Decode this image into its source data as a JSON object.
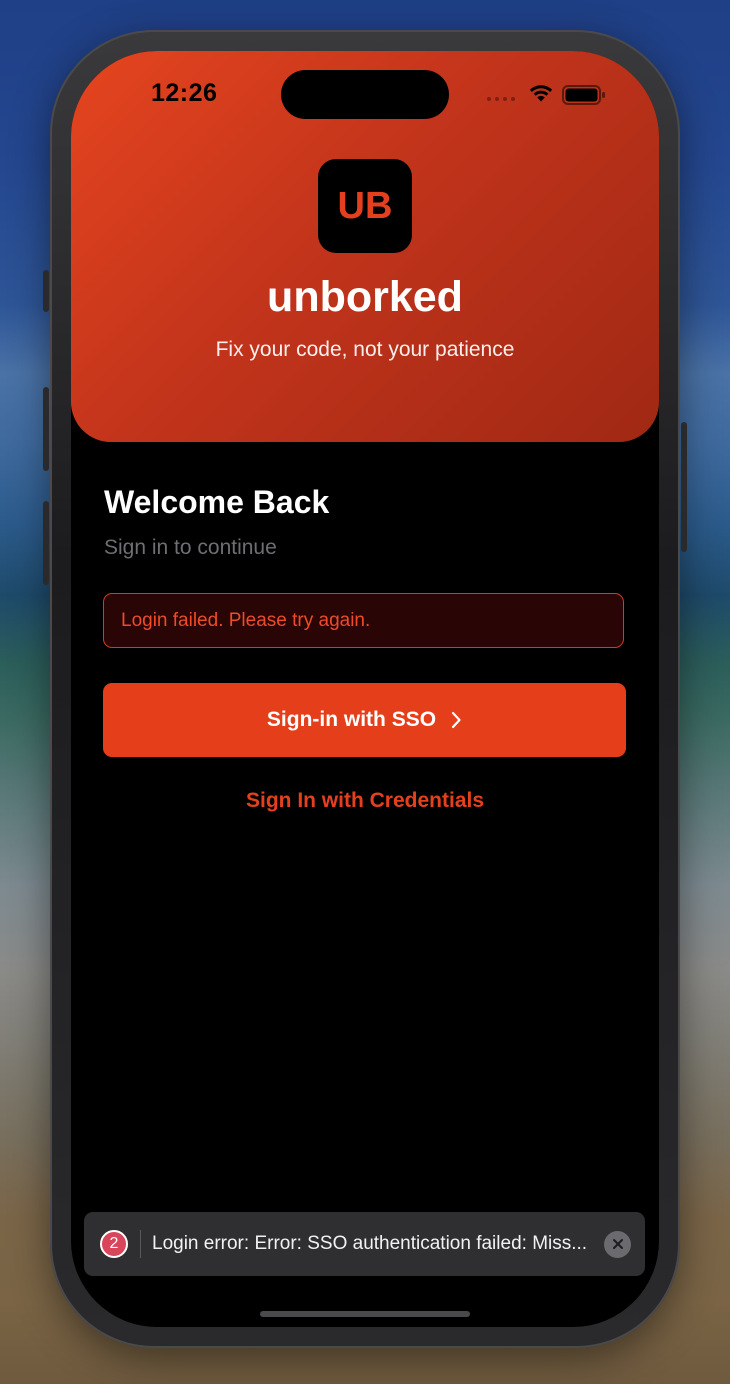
{
  "status_bar": {
    "time": "12:26",
    "icons": [
      "signal-dots-icon",
      "wifi-icon",
      "battery-icon"
    ]
  },
  "header": {
    "logo_text": "UB",
    "app_name": "unborked",
    "tagline": "Fix your code, not your patience"
  },
  "login": {
    "title": "Welcome Back",
    "subtitle": "Sign in to continue",
    "error_message": "Login failed. Please try again.",
    "sso_button_label": "Sign-in with SSO",
    "sso_button_icon": "chevron-right-icon",
    "credentials_link_label": "Sign In with Credentials"
  },
  "toast": {
    "count": "2",
    "message": "Login error: Error: SSO authentication failed: Miss...",
    "close_icon": "close-icon"
  },
  "colors": {
    "accent": "#e53e1b",
    "error_border": "#d13b22",
    "error_text": "#ef4a2a",
    "badge": "#d9455a"
  }
}
